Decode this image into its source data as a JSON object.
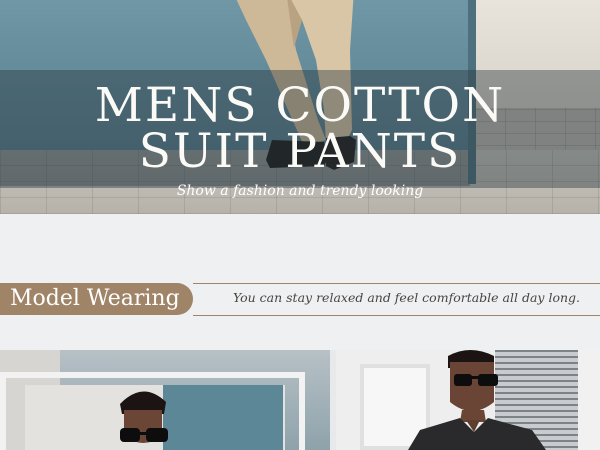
{
  "hero": {
    "title_line1": "MENS COTTON",
    "title_line2": "SUIT PANTS",
    "subtitle": "Show a fashion and trendy looking"
  },
  "section": {
    "label": "Model Wearing",
    "tagline": "You can stay relaxed and feel comfortable all day long."
  },
  "colors": {
    "accent": "#a08468",
    "wall_blue": "#5f8797",
    "background": "#eef0f2"
  }
}
